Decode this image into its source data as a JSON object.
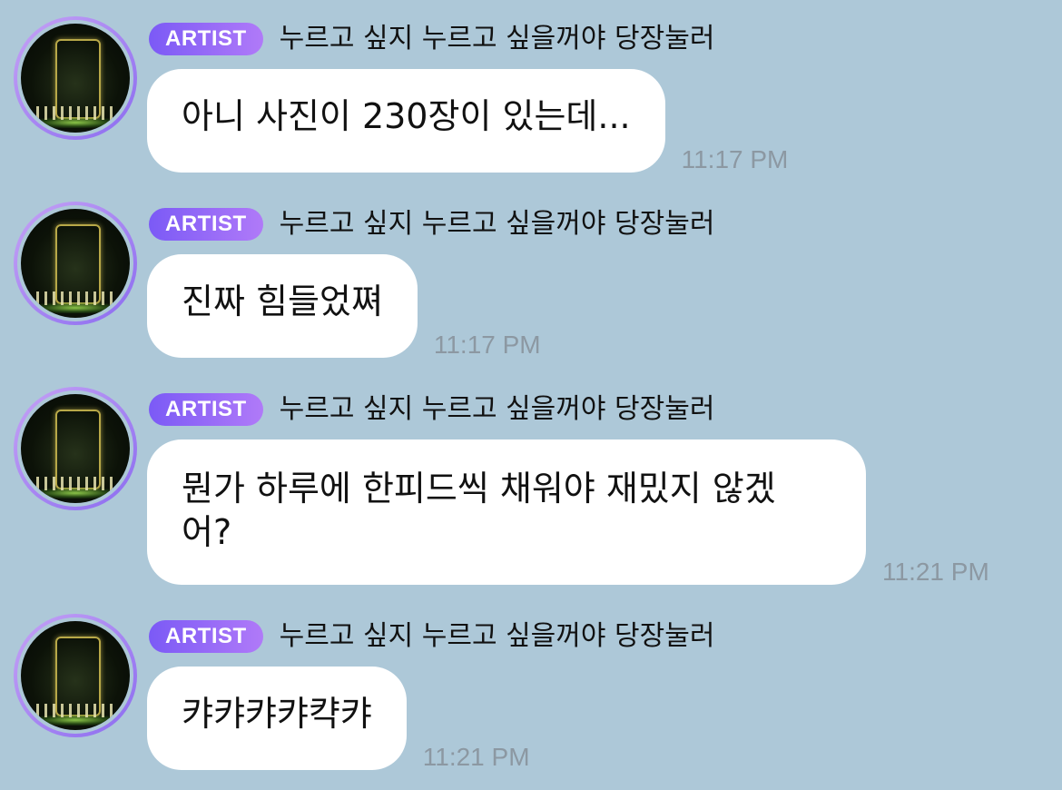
{
  "theme": {
    "chat_bg": "#adc8d8",
    "badge_gradient": [
      "#7b5af6",
      "#b07af8"
    ],
    "avatar_ring_gradient": [
      "#c6a2f5",
      "#8b6cf0"
    ]
  },
  "messages": [
    {
      "badge": "ARTIST",
      "sender": "누르고 싶지 누르고 싶을꺼야 당장눌러",
      "avatar_icon": "artist-avatar-stage-photo",
      "text": "아니 사진이 230장이 있는데...",
      "time": "11:17 PM"
    },
    {
      "badge": "ARTIST",
      "sender": "누르고 싶지 누르고 싶을꺼야 당장눌러",
      "avatar_icon": "artist-avatar-stage-photo",
      "text": "진짜 힘들었쪄",
      "time": "11:17 PM"
    },
    {
      "badge": "ARTIST",
      "sender": "누르고 싶지 누르고 싶을꺼야 당장눌러",
      "avatar_icon": "artist-avatar-stage-photo",
      "text": "뭔가 하루에 한피드씩 채워야 재밌지 않겠\n어?",
      "time": "11:21 PM"
    },
    {
      "badge": "ARTIST",
      "sender": "누르고 싶지 누르고 싶을꺼야 당장눌러",
      "avatar_icon": "artist-avatar-stage-photo",
      "text": "캬캬캬캬캭캬",
      "time": "11:21 PM"
    }
  ]
}
